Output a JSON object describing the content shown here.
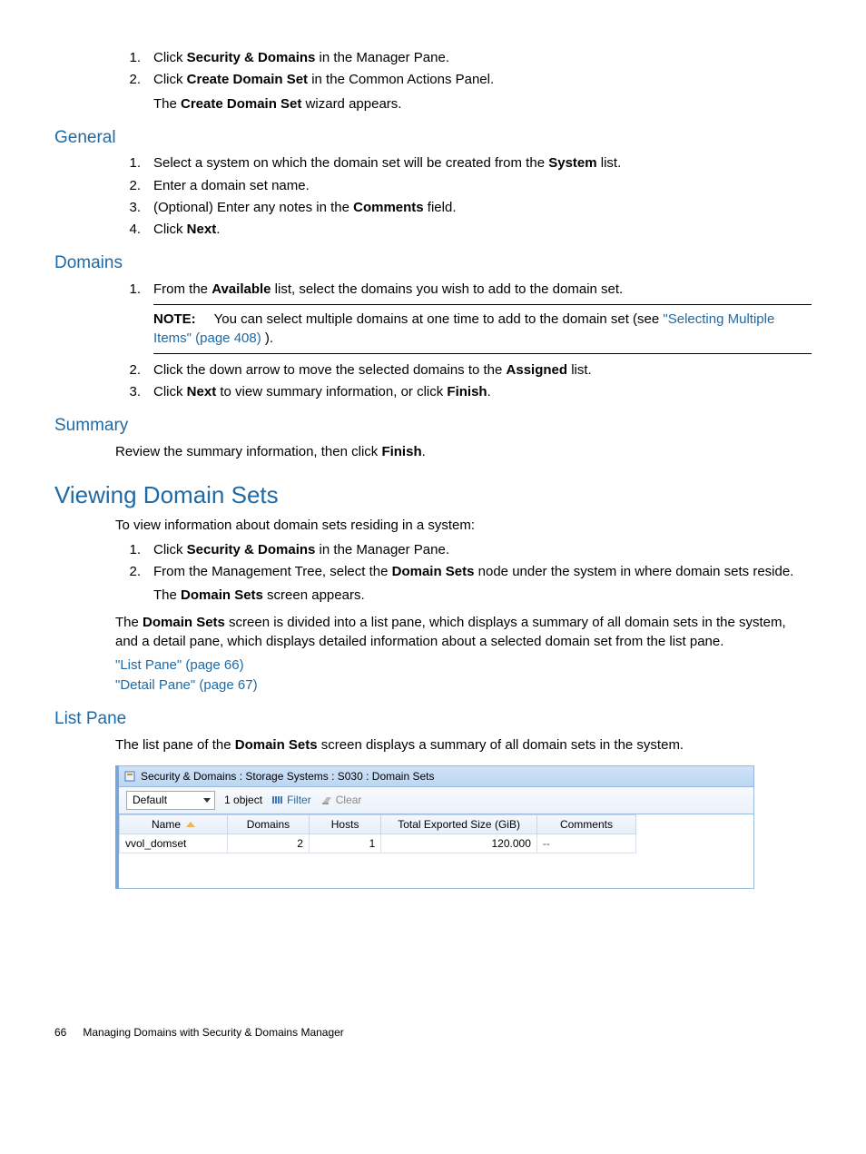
{
  "intro_steps": [
    {
      "num": "1.",
      "pre": "Click ",
      "bold": "Security & Domains",
      "post": " in the Manager Pane."
    },
    {
      "num": "2.",
      "pre": "Click ",
      "bold": "Create Domain Set",
      "post": " in the Common Actions Panel.",
      "after_pre": "The ",
      "after_bold": "Create Domain Set",
      "after_post": " wizard appears."
    }
  ],
  "general": {
    "heading": "General",
    "steps": [
      {
        "num": "1.",
        "pre": "Select a system on which the domain set will be created from the ",
        "bold": "System",
        "post": " list."
      },
      {
        "num": "2.",
        "text": "Enter a domain set name."
      },
      {
        "num": "3.",
        "pre": "(Optional) Enter any notes in the ",
        "bold": "Comments",
        "post": " field."
      },
      {
        "num": "4.",
        "pre": "Click ",
        "bold": "Next",
        "post": "."
      }
    ]
  },
  "domains": {
    "heading": "Domains",
    "step1": {
      "num": "1.",
      "pre": "From the ",
      "bold": "Available",
      "post": " list, select the domains you wish to add to the domain set."
    },
    "note": {
      "label": "NOTE:",
      "text": "You can select multiple domains at one time to add to the domain set (see ",
      "link": "\"Selecting Multiple Items\" (page 408)",
      "tail": " )."
    },
    "step2": {
      "num": "2.",
      "pre": "Click the down arrow to move the selected domains to the ",
      "bold": "Assigned",
      "post": " list."
    },
    "step3": {
      "num": "3.",
      "pre": "Click ",
      "bold": "Next",
      "post_pre": " to view summary information, or click ",
      "bold2": "Finish",
      "post": "."
    }
  },
  "summary": {
    "heading": "Summary",
    "text_pre": "Review the summary information, then click ",
    "text_bold": "Finish",
    "text_post": "."
  },
  "viewing": {
    "heading": "Viewing Domain Sets",
    "intro": "To view information about domain sets residing in a system:",
    "steps": [
      {
        "num": "1.",
        "pre": "Click ",
        "bold": "Security & Domains",
        "post": " in the Manager Pane."
      },
      {
        "num": "2.",
        "pre": "From the Management Tree, select the ",
        "bold": "Domain Sets",
        "post": " node under the system in where domain sets reside.",
        "after_pre": "The ",
        "after_bold": "Domain Sets",
        "after_post": " screen appears."
      }
    ],
    "para_pre": "The ",
    "para_bold": "Domain Sets",
    "para_post": " screen is divided into a list pane, which displays a summary of all domain sets in the system, and a detail pane, which displays detailed information about a selected domain set from the list pane.",
    "links": [
      "\"List Pane\" (page 66)",
      "\"Detail Pane\" (page 67)"
    ]
  },
  "listpane": {
    "heading": "List Pane",
    "text_pre": "The list pane of the ",
    "text_bold": "Domain Sets",
    "text_post": " screen displays a summary of all domain sets in the system."
  },
  "screenshot": {
    "title": "Security & Domains : Storage Systems : S030 : Domain Sets",
    "select": "Default",
    "count": "1 object",
    "filter": "Filter",
    "clear": "Clear",
    "columns": [
      "Name",
      "Domains",
      "Hosts",
      "Total Exported Size (GiB)",
      "Comments"
    ],
    "row": {
      "name": "vvol_domset",
      "domains": "2",
      "hosts": "1",
      "size": "120.000",
      "comments": "--"
    }
  },
  "footer": {
    "page": "66",
    "title": "Managing Domains with Security & Domains Manager"
  }
}
